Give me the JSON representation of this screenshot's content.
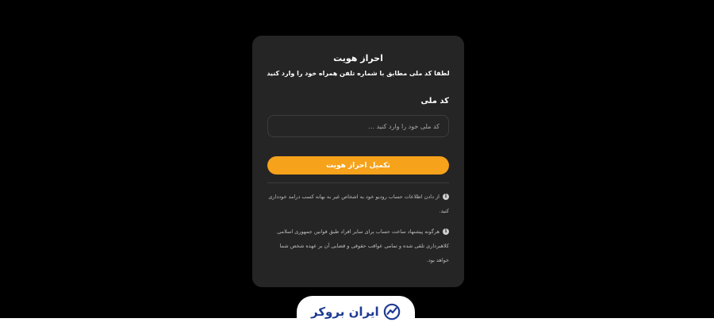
{
  "card": {
    "title": "احراز هویت",
    "subtitle": "لطفا کد ملی مطابق با شماره تلفن همراه خود را وارد کنید",
    "field_label": "کد ملی",
    "input_value": "",
    "input_placeholder": "کد ملی خود را وارد کنید ...",
    "submit_label": "تکمیل احراز هویت",
    "accent_color": "#f7a21b"
  },
  "notices": [
    {
      "icon": "info-icon",
      "text": "از دادن اطلاعات حساب رودیو خود به اشخاص غیر به بهانه کسب درامد خودداری کنید."
    },
    {
      "icon": "info-icon",
      "text": "هرگونه پیشنهاد ساخت حساب برای سایر افراد طبق قوانین جمهوری اسلامی کلاهبرداری تلقی شده و تمامی عواقب حقوقی و قضایی آن بر عهده شخص شما خواهد بود."
    }
  ],
  "footer": {
    "logo_text": "ایران بروکر",
    "logo_icon": "chart-check-icon",
    "brand_color": "#1f3a93"
  }
}
